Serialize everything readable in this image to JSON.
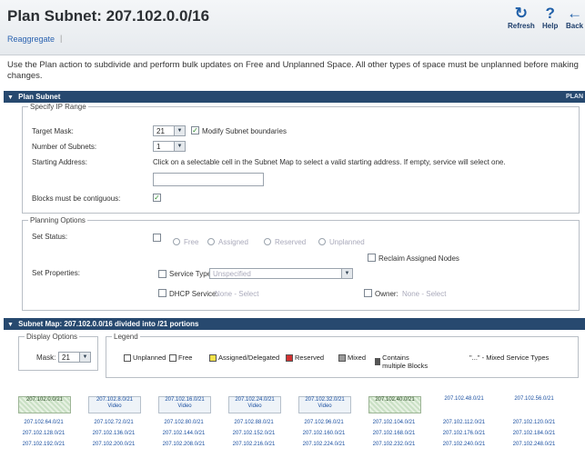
{
  "header": {
    "title": "Plan Subnet: 207.102.0.0/16",
    "reaggregate_link": "Reaggregate",
    "separator": "|",
    "toolbar": {
      "refresh": "Refresh",
      "help": "Help",
      "back": "Back"
    }
  },
  "intro": "Use the Plan action to subdivide and perform bulk updates on Free and Unplanned Space. All other types of space must be unplanned before making changes.",
  "plan_subnet": {
    "bar_label": "Plan Subnet",
    "bar_right": "PLAN",
    "specify_ip_range": {
      "legend": "Specify IP Range",
      "target_mask_label": "Target Mask:",
      "target_mask_value": "21",
      "modify_boundaries_label": "Modify Subnet boundaries",
      "number_of_subnets_label": "Number of Subnets:",
      "number_of_subnets_value": "1",
      "starting_address_label": "Starting Address:",
      "starting_address_hint": "Click on a selectable cell in the Subnet Map to select a valid starting address. If empty, service will select one.",
      "starting_address_value": "",
      "contiguous_label": "Blocks must be contiguous:"
    },
    "planning_options": {
      "legend": "Planning Options",
      "set_status_label": "Set Status:",
      "status_options": [
        "Free",
        "Assigned",
        "Reserved",
        "Unplanned"
      ],
      "reclaim_label": "Reclaim Assigned Nodes",
      "set_properties_label": "Set Properties:",
      "service_type_label": "Service Type",
      "service_type_value": "Unspecified",
      "dhcp_service_label": "DHCP Service:",
      "dhcp_service_value": "None - Select",
      "owner_label": "Owner:",
      "owner_value": "None - Select"
    }
  },
  "subnet_map": {
    "bar_label": "Subnet Map: 207.102.0.0/16 divided into /21 portions",
    "display_options": {
      "legend": "Display Options",
      "mask_label": "Mask:",
      "mask_value": "21"
    },
    "legend": {
      "title": "Legend",
      "items": [
        {
          "label": "Unplanned",
          "color": "#ffffff"
        },
        {
          "label": "Free",
          "color": "#ffffff"
        },
        {
          "label": "Assigned/Delegated",
          "color": "#f3e24a"
        },
        {
          "label": "Reserved",
          "color": "#d23232"
        },
        {
          "label": "Mixed",
          "color": "#9a9a9a"
        },
        {
          "label": "Contains multiple Blocks",
          "color": "#555555"
        }
      ],
      "mixed_service": "\"...\" - Mixed Service Types"
    },
    "rows": [
      [
        {
          "addr": "207.102.0.0/21",
          "sub": "",
          "style": "hatch"
        },
        {
          "addr": "207.102.8.0/21",
          "sub": "Video",
          "style": "boxed"
        },
        {
          "addr": "207.102.16.0/21",
          "sub": "Video",
          "style": "boxed"
        },
        {
          "addr": "207.102.24.0/21",
          "sub": "Video",
          "style": "boxed"
        },
        {
          "addr": "207.102.32.0/21",
          "sub": "Video",
          "style": "boxed"
        },
        {
          "addr": "207.102.40.0/21",
          "sub": "",
          "style": "hatch"
        },
        {
          "addr": "207.102.48.0/21",
          "sub": "",
          "style": "plain"
        },
        {
          "addr": "207.102.56.0/21",
          "sub": "",
          "style": "plain"
        }
      ],
      [
        "207.102.64.0/21",
        "207.102.72.0/21",
        "207.102.80.0/21",
        "207.102.88.0/21",
        "207.102.96.0/21",
        "207.102.104.0/21",
        "207.102.112.0/21",
        "207.102.120.0/21"
      ],
      [
        "207.102.128.0/21",
        "207.102.136.0/21",
        "207.102.144.0/21",
        "207.102.152.0/21",
        "207.102.160.0/21",
        "207.102.168.0/21",
        "207.102.176.0/21",
        "207.102.184.0/21"
      ],
      [
        "207.102.192.0/21",
        "207.102.200.0/21",
        "207.102.208.0/21",
        "207.102.216.0/21",
        "207.102.224.0/21",
        "207.102.232.0/21",
        "207.102.240.0/21",
        "207.102.248.0/21"
      ]
    ]
  }
}
